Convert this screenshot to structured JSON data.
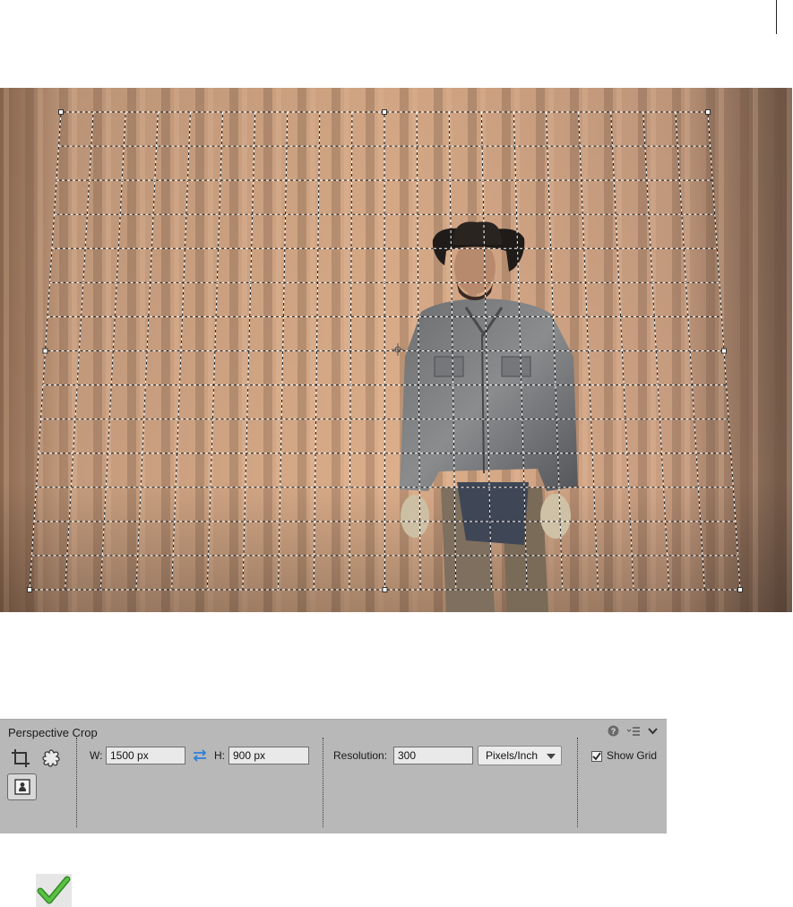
{
  "canvas": {
    "commit_icon": "checkmark-icon",
    "cancel_icon": "cancel-icon"
  },
  "panel": {
    "title": "Perspective Crop",
    "help_icon": "help-icon",
    "menu_icon": "panel-menu-icon",
    "collapse_icon": "chevron-down-icon",
    "tools": [
      "crop-tool-icon",
      "cookie-cutter-icon",
      "perspective-crop-icon"
    ],
    "width_label": "W:",
    "width_value": "1500 px",
    "swap_icon": "swap-arrows-icon",
    "height_label": "H:",
    "height_value": "900 px",
    "resolution_label": "Resolution:",
    "resolution_value": "300",
    "units_value": "Pixels/Inch",
    "show_grid_label": "Show Grid",
    "show_grid_checked": true
  },
  "bottom": {
    "icon": "large-checkmark-icon"
  },
  "colors": {
    "panel_bg": "#b8b8b8",
    "commit_green": "#3aa02a",
    "cancel_red": "#c0202a",
    "swap_blue": "#2f7fd8"
  }
}
